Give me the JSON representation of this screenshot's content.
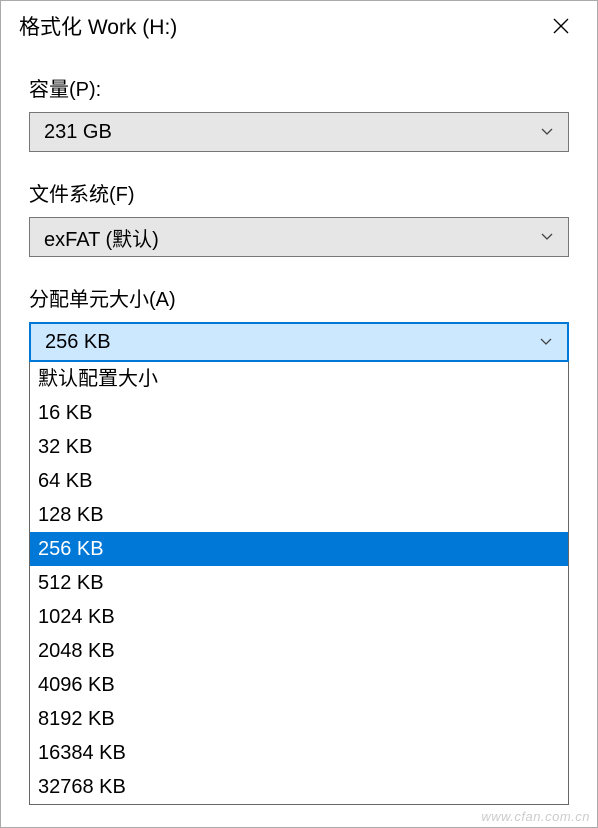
{
  "titlebar": {
    "title": "格式化 Work (H:)"
  },
  "capacity": {
    "label": "容量(P):",
    "value": "231 GB"
  },
  "filesystem": {
    "label": "文件系统(F)",
    "value": "exFAT (默认)"
  },
  "allocunit": {
    "label": "分配单元大小(A)",
    "value": "256 KB",
    "options": [
      "默认配置大小",
      "16 KB",
      "32 KB",
      "64 KB",
      "128 KB",
      "256 KB",
      "512 KB",
      "1024 KB",
      "2048 KB",
      "4096 KB",
      "8192 KB",
      "16384 KB",
      "32768 KB"
    ],
    "selected_index": 5
  },
  "watermark": "www.cfan.com.cn"
}
